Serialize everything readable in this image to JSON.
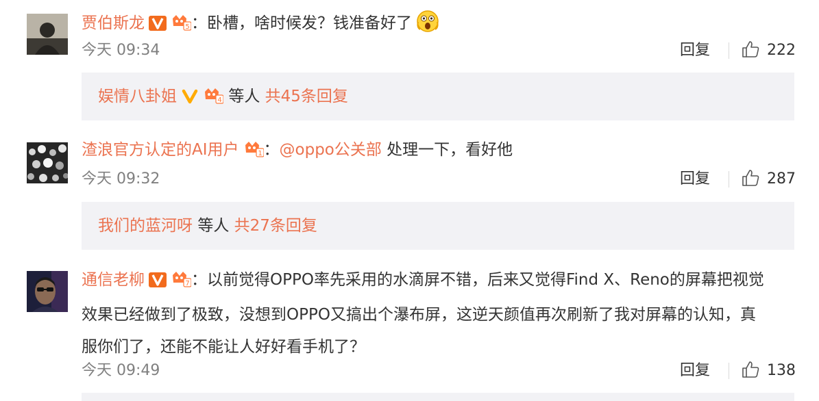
{
  "colors": {
    "accent": "#eb7350",
    "text": "#333333",
    "muted": "#808080",
    "sub_bg": "#f2f2f5",
    "verified_orange": "#f26b1d",
    "verified_yellow": "#ffab00"
  },
  "comments": [
    {
      "name": "贾伯斯龙",
      "badges": [
        "verified-v-orange-icon",
        "vip-crown-icon-5"
      ],
      "separator": "：",
      "text": "卧槽，啥时候发？钱准备好了",
      "emoji": "shocked-face-emoji",
      "time": "今天 09:34",
      "reply_label": "回复",
      "likes": "222",
      "replies": {
        "user": "娱情八卦姐",
        "badges": [
          "verified-v-yellow-icon",
          "vip-crown-icon-4"
        ],
        "others_label": "等人",
        "count_label": "共45条回复"
      }
    },
    {
      "name": "渣浪官方认定的AI用户",
      "badges": [
        "vip-crown-icon-1"
      ],
      "separator": "：",
      "mention": "@oppo公关部",
      "text": " 处理一下，看好他",
      "time": "今天 09:32",
      "reply_label": "回复",
      "likes": "287",
      "replies": {
        "user": "我们的蓝河呀",
        "others_label": "等人",
        "count_label": "共27条回复"
      }
    },
    {
      "name": "通信老柳",
      "badges": [
        "verified-v-orange-icon",
        "vip-crown-icon-7"
      ],
      "separator": "：",
      "text_lines": [
        "以前觉得OPPO率先采用的水滴屏不错，后来又觉得Find X、Reno的屏幕把视觉",
        "效果已经做到了极致，没想到OPPO又搞出个瀑布屏，这逆天颜值再次刷新了我对屏幕的认知，真",
        "服你们了，还能不能让人好好看手机了？"
      ],
      "time": "今天 09:49",
      "reply_label": "回复",
      "likes": "138"
    }
  ],
  "vip_levels": {
    "c1": "5",
    "c1_sub": "4",
    "c2": "1",
    "c3": "7"
  }
}
